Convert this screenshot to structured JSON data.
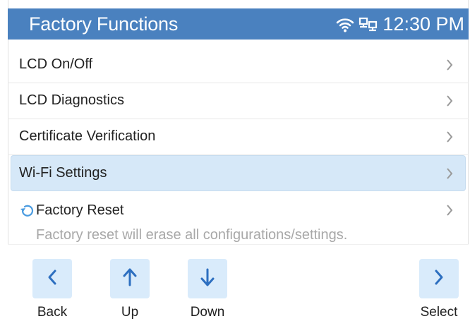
{
  "header": {
    "title": "Factory Functions",
    "time": "12:30 PM",
    "icons": [
      "wifi-icon",
      "ethernet-icon"
    ]
  },
  "menu": {
    "items": [
      {
        "label": "LCD On/Off",
        "icon": "chevron-right-icon"
      },
      {
        "label": "LCD Diagnostics",
        "icon": "chevron-right-icon"
      },
      {
        "label": "Certificate Verification",
        "icon": "chevron-right-icon"
      },
      {
        "label": "Wi-Fi Settings",
        "icon": "chevron-right-icon",
        "selected": true
      },
      {
        "label": "Factory Reset",
        "icon": "reset-icon",
        "hint": "Factory reset will erase all configurations/settings."
      }
    ]
  },
  "softkeys": [
    {
      "label": "Back",
      "icon": "chevron-left-icon"
    },
    {
      "label": "Up",
      "icon": "arrow-up-icon"
    },
    {
      "label": "Down",
      "icon": "arrow-down-icon"
    },
    {
      "label": "Select",
      "icon": "chevron-right-icon"
    }
  ],
  "colors": {
    "titlebar": "#4a81bf",
    "selected_row": "#d6e8f8",
    "softkey_bg": "#d9ebfb",
    "softkey_icon": "#2d6fc0"
  }
}
